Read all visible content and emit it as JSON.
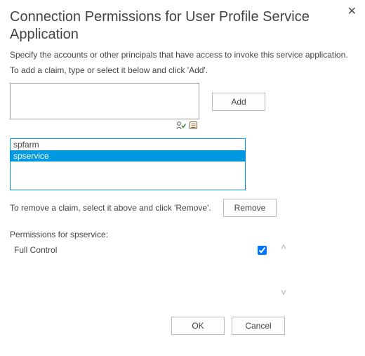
{
  "title": "Connection Permissions for User Profile Service Application",
  "description": "Specify the accounts or other principals that have access to invoke this service application.",
  "add_instruction": "To add a claim, type or select it below and click 'Add'.",
  "claim_input": {
    "value": "",
    "placeholder": ""
  },
  "buttons": {
    "add": "Add",
    "remove": "Remove",
    "ok": "OK",
    "cancel": "Cancel"
  },
  "principals": {
    "items": [
      "spfarm",
      "spservice"
    ],
    "selected_index": 1
  },
  "remove_instruction": "To remove a claim, select it above and click 'Remove'.",
  "permissions_label": "Permissions for spservice:",
  "permissions": [
    {
      "name": "Full Control",
      "checked": true
    }
  ],
  "close_glyph": "✕",
  "scroll": {
    "up": "˄",
    "down": "˅"
  }
}
